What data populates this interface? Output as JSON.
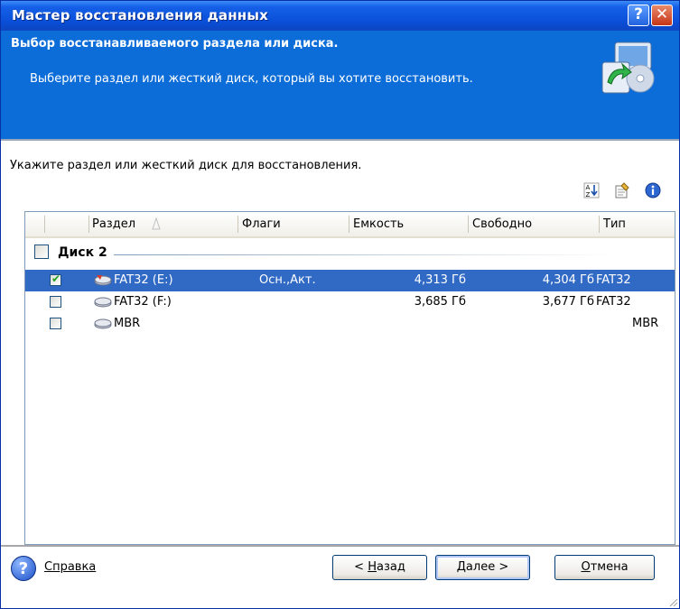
{
  "window": {
    "title": "Мастер восстановления данных",
    "help_glyph": "?",
    "close_glyph": "✕"
  },
  "header": {
    "title": "Выбор восстанавливаемого раздела или диска.",
    "subtitle": "Выберите раздел или жесткий диск, который вы хотите восстановить."
  },
  "instruction": "Укажите раздел или жесткий диск для восстановления.",
  "toolbar_icons": [
    "sort-icon",
    "properties-icon",
    "info-icon"
  ],
  "columns": [
    "Раздел",
    "Флаги",
    "Емкость",
    "Свободно",
    "Тип"
  ],
  "group": {
    "label": "Диск 2",
    "checked": false
  },
  "rows": [
    {
      "name": "FAT32 (E:)",
      "flags": "Осн.,Акт.",
      "capacity": "4,313 Гб",
      "free": "4,304 Гб",
      "type": "FAT32",
      "checked": true,
      "selected": true
    },
    {
      "name": "FAT32 (F:)",
      "flags": "",
      "capacity": "3,685 Гб",
      "free": "3,677 Гб",
      "type": "FAT32",
      "checked": false,
      "selected": false
    },
    {
      "name": "MBR",
      "flags": "",
      "capacity": "",
      "free": "",
      "type": "MBR",
      "checked": false,
      "selected": false
    }
  ],
  "footer": {
    "help_glyph": "?",
    "help_label": "Справка",
    "back_prefix": "< ",
    "back_ul": "Н",
    "back_rest": "азад",
    "next_ul": "Д",
    "next_rest": "алее >",
    "cancel_ul": "О",
    "cancel_rest": "тмена"
  },
  "colors": {
    "header_blue": "#0c6dd9",
    "selection": "#316ac5",
    "titlebar": "#0a4fd8"
  }
}
